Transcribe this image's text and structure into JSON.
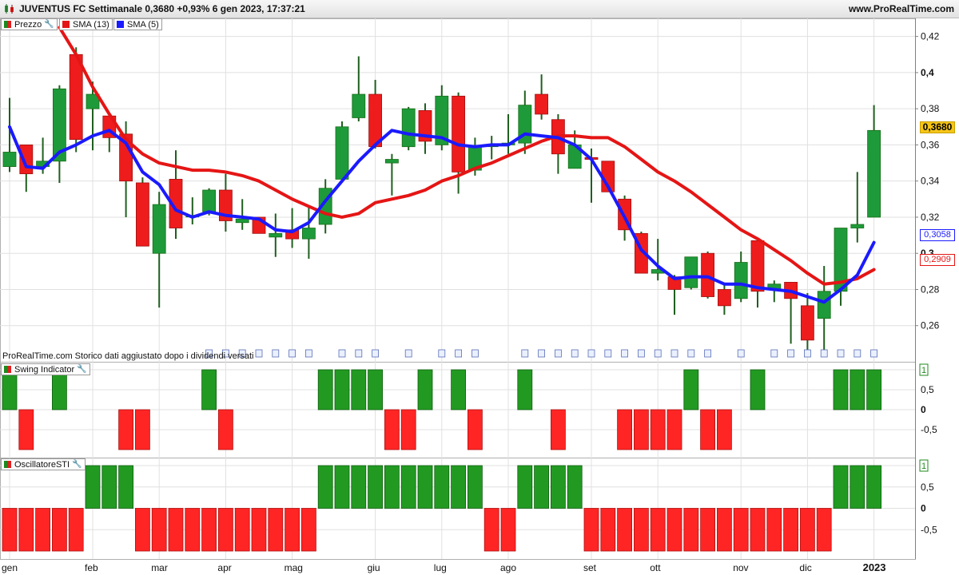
{
  "window": {
    "title": "JUVENTUS FC Settimanale 0,3680 +0,93% 6 gen 2023, 17:37:21",
    "site": "www.ProRealTime.com"
  },
  "legend": {
    "price": "Prezzo",
    "sma13": "SMA (13)",
    "sma5": "SMA (5)",
    "swing": "Swing Indicator",
    "oscillator": "OscillatoreSTI"
  },
  "source_note": "ProRealTime.com Storico dati aggiustato dopo i dividendi versati",
  "last_value_tags": {
    "price": "0,3680",
    "sma5": "0,3058",
    "sma13": "0,2909"
  },
  "colors": {
    "up": "#1e9a3a",
    "down": "#ee1c1c",
    "sma13": "#e51515",
    "sma5": "#1a1aff",
    "grid": "#e0e0e0",
    "wick": "#1f5f1f"
  },
  "chart_data": [
    {
      "type": "candlestick",
      "title": "JUVENTUS FC Settimanale",
      "x_axis_labels": [
        "gen",
        "feb",
        "mar",
        "apr",
        "mag",
        "giu",
        "lug",
        "ago",
        "set",
        "ott",
        "nov",
        "dic",
        "2023"
      ],
      "y_tick_labels": [
        "0,26",
        "0,28",
        "0,3",
        "0,32",
        "0,34",
        "0,36",
        "0,38",
        "0,4",
        "0,42"
      ],
      "ylim": [
        0.24,
        0.43
      ],
      "candles": [
        {
          "o": 0.348,
          "h": 0.386,
          "l": 0.345,
          "c": 0.356
        },
        {
          "o": 0.36,
          "h": 0.36,
          "l": 0.334,
          "c": 0.344
        },
        {
          "o": 0.348,
          "h": 0.364,
          "l": 0.344,
          "c": 0.351
        },
        {
          "o": 0.351,
          "h": 0.393,
          "l": 0.339,
          "c": 0.391
        },
        {
          "o": 0.41,
          "h": 0.414,
          "l": 0.356,
          "c": 0.363
        },
        {
          "o": 0.38,
          "h": 0.395,
          "l": 0.357,
          "c": 0.388
        },
        {
          "o": 0.376,
          "h": 0.377,
          "l": 0.356,
          "c": 0.364
        },
        {
          "o": 0.366,
          "h": 0.373,
          "l": 0.32,
          "c": 0.34
        },
        {
          "o": 0.339,
          "h": 0.342,
          "l": 0.304,
          "c": 0.304
        },
        {
          "o": 0.3,
          "h": 0.334,
          "l": 0.27,
          "c": 0.327
        },
        {
          "o": 0.341,
          "h": 0.357,
          "l": 0.308,
          "c": 0.314
        },
        {
          "o": 0.321,
          "h": 0.331,
          "l": 0.316,
          "c": 0.321
        },
        {
          "o": 0.323,
          "h": 0.336,
          "l": 0.321,
          "c": 0.335
        },
        {
          "o": 0.335,
          "h": 0.344,
          "l": 0.312,
          "c": 0.318
        },
        {
          "o": 0.317,
          "h": 0.33,
          "l": 0.313,
          "c": 0.319
        },
        {
          "o": 0.32,
          "h": 0.32,
          "l": 0.312,
          "c": 0.311
        },
        {
          "o": 0.309,
          "h": 0.322,
          "l": 0.298,
          "c": 0.311
        },
        {
          "o": 0.313,
          "h": 0.325,
          "l": 0.303,
          "c": 0.308
        },
        {
          "o": 0.308,
          "h": 0.326,
          "l": 0.297,
          "c": 0.314
        },
        {
          "o": 0.316,
          "h": 0.341,
          "l": 0.311,
          "c": 0.336
        },
        {
          "o": 0.341,
          "h": 0.373,
          "l": 0.339,
          "c": 0.37
        },
        {
          "o": 0.375,
          "h": 0.409,
          "l": 0.373,
          "c": 0.388
        },
        {
          "o": 0.388,
          "h": 0.396,
          "l": 0.358,
          "c": 0.359
        },
        {
          "o": 0.35,
          "h": 0.355,
          "l": 0.332,
          "c": 0.352
        },
        {
          "o": 0.359,
          "h": 0.381,
          "l": 0.357,
          "c": 0.38
        },
        {
          "o": 0.379,
          "h": 0.383,
          "l": 0.355,
          "c": 0.362
        },
        {
          "o": 0.36,
          "h": 0.393,
          "l": 0.357,
          "c": 0.387
        },
        {
          "o": 0.387,
          "h": 0.389,
          "l": 0.333,
          "c": 0.345
        },
        {
          "o": 0.346,
          "h": 0.364,
          "l": 0.343,
          "c": 0.359
        },
        {
          "o": 0.359,
          "h": 0.365,
          "l": 0.352,
          "c": 0.36
        },
        {
          "o": 0.36,
          "h": 0.377,
          "l": 0.355,
          "c": 0.361
        },
        {
          "o": 0.361,
          "h": 0.39,
          "l": 0.355,
          "c": 0.382
        },
        {
          "o": 0.388,
          "h": 0.399,
          "l": 0.374,
          "c": 0.377
        },
        {
          "o": 0.374,
          "h": 0.377,
          "l": 0.344,
          "c": 0.355
        },
        {
          "o": 0.347,
          "h": 0.368,
          "l": 0.347,
          "c": 0.36
        },
        {
          "o": 0.353,
          "h": 0.358,
          "l": 0.328,
          "c": 0.352
        },
        {
          "o": 0.351,
          "h": 0.351,
          "l": 0.335,
          "c": 0.334
        },
        {
          "o": 0.33,
          "h": 0.332,
          "l": 0.307,
          "c": 0.313
        },
        {
          "o": 0.311,
          "h": 0.312,
          "l": 0.29,
          "c": 0.289
        },
        {
          "o": 0.289,
          "h": 0.308,
          "l": 0.285,
          "c": 0.291
        },
        {
          "o": 0.287,
          "h": 0.288,
          "l": 0.266,
          "c": 0.28
        },
        {
          "o": 0.281,
          "h": 0.298,
          "l": 0.28,
          "c": 0.298
        },
        {
          "o": 0.3,
          "h": 0.301,
          "l": 0.275,
          "c": 0.276
        },
        {
          "o": 0.28,
          "h": 0.283,
          "l": 0.266,
          "c": 0.271
        },
        {
          "o": 0.275,
          "h": 0.301,
          "l": 0.273,
          "c": 0.295
        },
        {
          "o": 0.307,
          "h": 0.307,
          "l": 0.27,
          "c": 0.279
        },
        {
          "o": 0.28,
          "h": 0.285,
          "l": 0.273,
          "c": 0.283
        },
        {
          "o": 0.284,
          "h": 0.284,
          "l": 0.25,
          "c": 0.275
        },
        {
          "o": 0.271,
          "h": 0.278,
          "l": 0.243,
          "c": 0.252
        },
        {
          "o": 0.264,
          "h": 0.293,
          "l": 0.246,
          "c": 0.279
        },
        {
          "o": 0.279,
          "h": 0.314,
          "l": 0.271,
          "c": 0.314
        },
        {
          "o": 0.314,
          "h": 0.345,
          "l": 0.306,
          "c": 0.316
        },
        {
          "o": 0.32,
          "h": 0.382,
          "l": 0.32,
          "c": 0.368
        }
      ],
      "series": [
        {
          "name": "SMA (13)",
          "values": [
            null,
            null,
            null,
            0.425,
            0.41,
            0.392,
            0.377,
            0.363,
            0.355,
            0.35,
            0.348,
            0.346,
            0.346,
            0.345,
            0.343,
            0.34,
            0.335,
            0.33,
            0.326,
            0.322,
            0.32,
            0.322,
            0.328,
            0.33,
            0.332,
            0.335,
            0.34,
            0.343,
            0.347,
            0.35,
            0.354,
            0.358,
            0.362,
            0.365,
            0.365,
            0.364,
            0.364,
            0.359,
            0.352,
            0.345,
            0.34,
            0.334,
            0.327,
            0.32,
            0.313,
            0.308,
            0.302,
            0.296,
            0.289,
            0.283,
            0.284,
            0.286,
            0.291
          ]
        },
        {
          "name": "SMA (5)",
          "values": [
            0.37,
            0.348,
            0.347,
            0.356,
            0.36,
            0.365,
            0.368,
            0.361,
            0.345,
            0.338,
            0.324,
            0.32,
            0.323,
            0.321,
            0.32,
            0.319,
            0.313,
            0.312,
            0.317,
            0.329,
            0.34,
            0.351,
            0.36,
            0.368,
            0.366,
            0.365,
            0.364,
            0.36,
            0.359,
            0.36,
            0.36,
            0.366,
            0.365,
            0.364,
            0.36,
            0.352,
            0.337,
            0.32,
            0.302,
            0.293,
            0.286,
            0.287,
            0.287,
            0.283,
            0.283,
            0.281,
            0.28,
            0.279,
            0.276,
            0.273,
            0.28,
            0.288,
            0.306
          ]
        }
      ]
    },
    {
      "type": "bar",
      "title": "Swing Indicator",
      "ylim": [
        -1,
        1
      ],
      "y_tick_labels": [
        "-0,5",
        "0",
        "0,5",
        "1"
      ],
      "values": [
        1,
        -1,
        0,
        1,
        0,
        0,
        0,
        -1,
        -1,
        0,
        0,
        0,
        1,
        -1,
        0,
        0,
        0,
        0,
        0,
        1,
        1,
        1,
        1,
        -1,
        -1,
        1,
        0,
        1,
        -1,
        0,
        0,
        1,
        0,
        -1,
        0,
        0,
        0,
        -1,
        -1,
        -1,
        -1,
        1,
        -1,
        -1,
        0,
        1,
        0,
        0,
        0,
        0,
        1,
        1,
        1
      ]
    },
    {
      "type": "bar",
      "title": "OscillatoreSTI",
      "ylim": [
        -1,
        1
      ],
      "y_tick_labels": [
        "-0,5",
        "0",
        "0,5",
        "1"
      ],
      "values": [
        -1,
        -1,
        -1,
        -1,
        -1,
        1,
        1,
        1,
        -1,
        -1,
        -1,
        -1,
        -1,
        -1,
        -1,
        -1,
        -1,
        -1,
        -1,
        1,
        1,
        1,
        1,
        1,
        1,
        1,
        1,
        1,
        1,
        -1,
        -1,
        1,
        1,
        1,
        1,
        -1,
        -1,
        -1,
        -1,
        -1,
        -1,
        -1,
        -1,
        -1,
        -1,
        -1,
        -1,
        -1,
        -1,
        -1,
        1,
        1,
        1
      ]
    }
  ]
}
